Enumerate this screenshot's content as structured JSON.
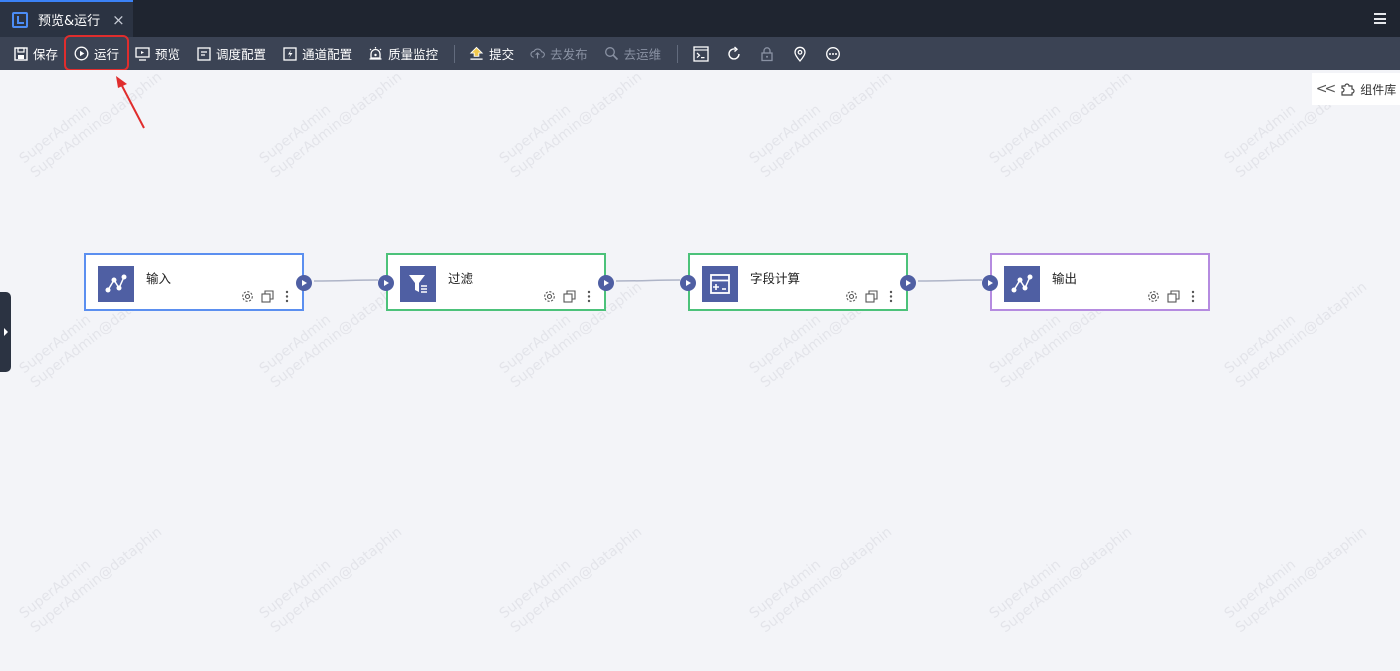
{
  "tab": {
    "title": "预览&运行",
    "close": "×"
  },
  "toolbar": {
    "save": "保存",
    "run": "运行",
    "preview": "预览",
    "schedule": "调度配置",
    "channel": "通道配置",
    "quality": "质量监控",
    "submit": "提交",
    "publish": "去发布",
    "ops": "去运维"
  },
  "component_library": {
    "label": "组件库"
  },
  "watermark": {
    "line1": "SuperAdmin",
    "line2": "SuperAdmin@dataphin"
  },
  "nodes": [
    {
      "title": "输入",
      "border_color": "#5b8ff0",
      "icon": "input-node-icon"
    },
    {
      "title": "过滤",
      "border_color": "#4cc27a",
      "icon": "filter-node-icon"
    },
    {
      "title": "字段计算",
      "border_color": "#4cc27a",
      "icon": "calculator-node-icon"
    },
    {
      "title": "输出",
      "border_color": "#b58be0",
      "icon": "output-node-icon"
    }
  ],
  "colors": {
    "accent": "#4f5fa3",
    "highlight": "#e02d2d",
    "toolbar": "#3b4354",
    "tabbar": "#1f2530"
  }
}
